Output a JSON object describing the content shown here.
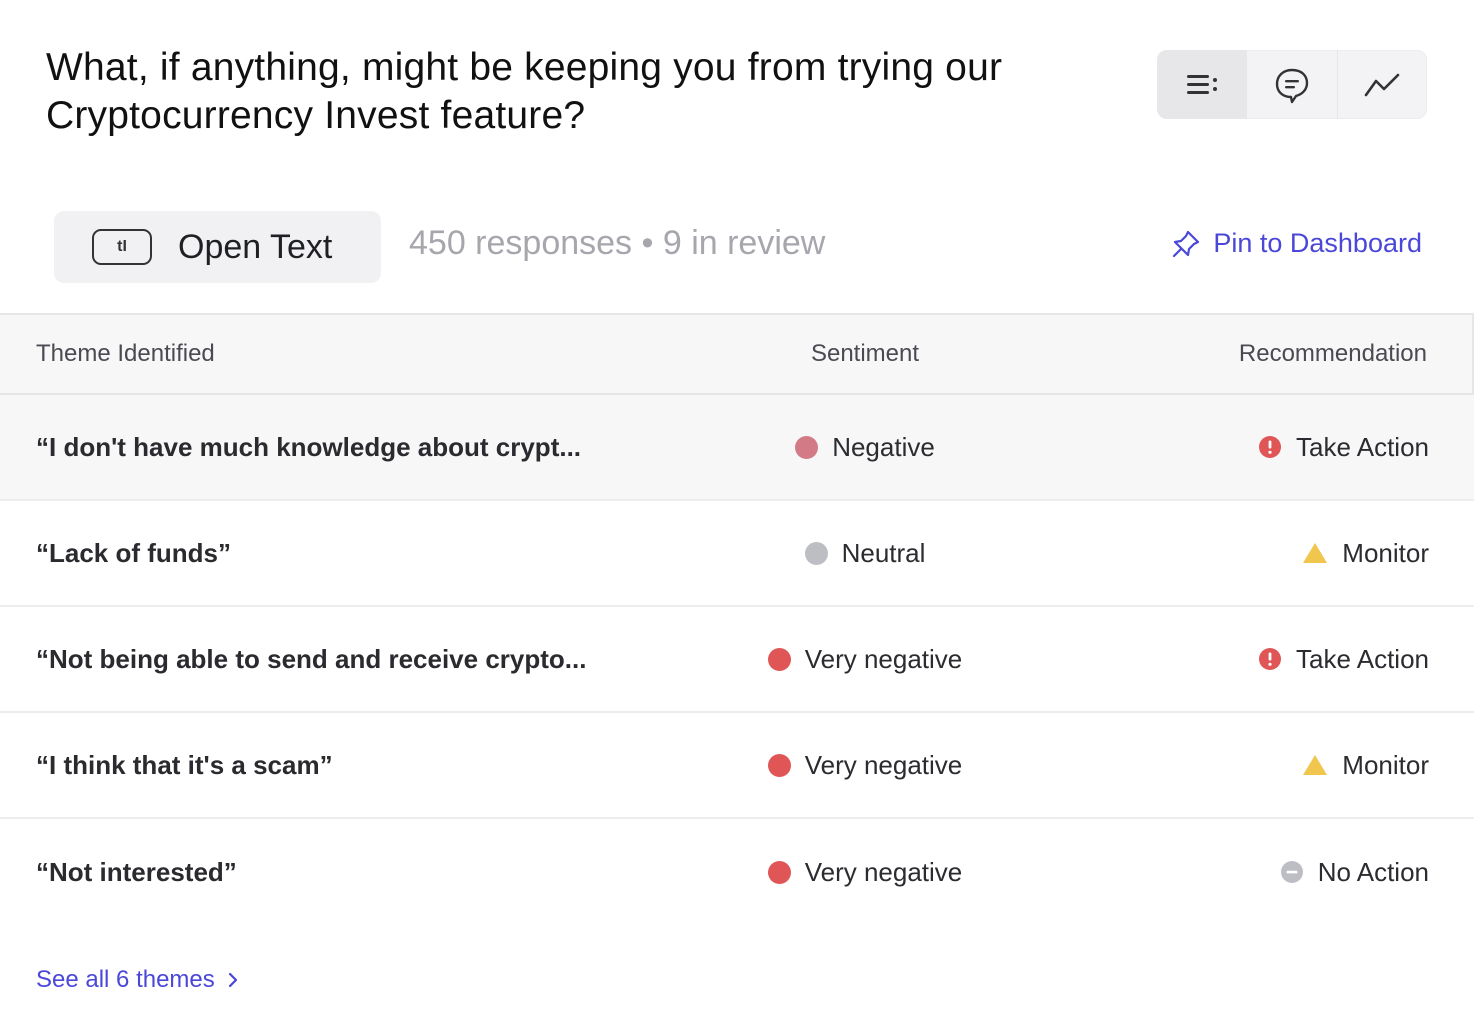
{
  "question": "What, if anything, might be keeping you from trying our Cryptocurrency Invest feature?",
  "type_chip": {
    "icon_text": "tI",
    "label": "Open Text"
  },
  "meta": "450 responses • 9 in review",
  "pin_label": "Pin to Dashboard",
  "table": {
    "headers": {
      "theme": "Theme Identified",
      "sentiment": "Sentiment",
      "recommendation": "Recommendation"
    },
    "rows": [
      {
        "theme": "“I don't have much knowledge about crypt...",
        "sentiment": "Negative",
        "sentiment_color": "#d27b86",
        "recommendation": "Take Action",
        "rec_icon": "alert-circle-icon"
      },
      {
        "theme": "“Lack of funds”",
        "sentiment": "Neutral",
        "sentiment_color": "#bdbdc4",
        "recommendation": "Monitor",
        "rec_icon": "warning-triangle-icon"
      },
      {
        "theme": "“Not being able to send and receive crypto...",
        "sentiment": "Very negative",
        "sentiment_color": "#e05656",
        "recommendation": "Take Action",
        "rec_icon": "alert-circle-icon"
      },
      {
        "theme": "“I think that it's a scam”",
        "sentiment": "Very negative",
        "sentiment_color": "#e05656",
        "recommendation": "Monitor",
        "rec_icon": "warning-triangle-icon"
      },
      {
        "theme": "“Not interested”",
        "sentiment": "Very negative",
        "sentiment_color": "#e05656",
        "recommendation": "No Action",
        "rec_icon": "minus-circle-icon"
      }
    ]
  },
  "see_all": "See all 6 themes",
  "colors": {
    "accent": "#4b47d9",
    "alert": "#e05656",
    "warning": "#f0c64e",
    "neutral": "#bdbdc4"
  }
}
